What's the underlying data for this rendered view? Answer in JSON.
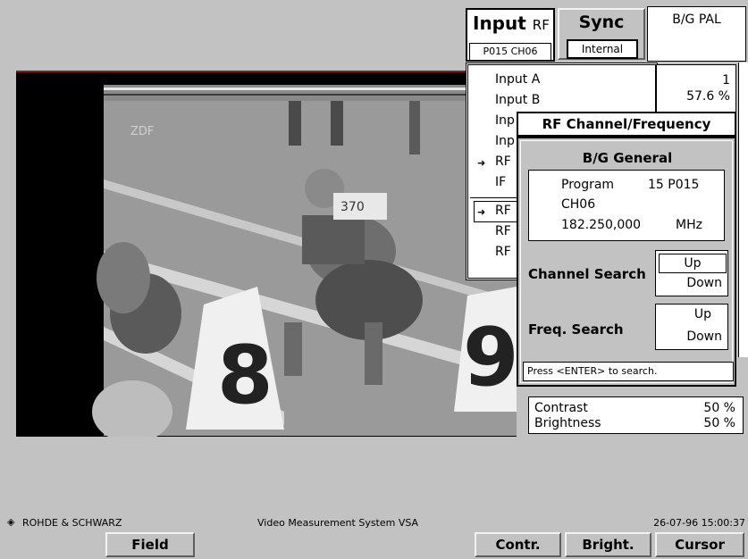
{
  "tabs": {
    "input": {
      "label": "Input",
      "source": "RF",
      "sub": "P015 CH06"
    },
    "sync": {
      "label": "Sync",
      "sub": "Internal"
    },
    "standard": {
      "label": "B/G PAL"
    }
  },
  "input_menu": {
    "items": [
      "Input A",
      "Input B",
      "Inp",
      "Inp",
      "RF",
      "IF",
      "RF",
      "RF",
      "RF"
    ],
    "selected_indices": [
      4,
      6
    ]
  },
  "info": {
    "line1": "1",
    "line2": "57.6 %"
  },
  "rf_dialog": {
    "title": "RF Channel/Frequency",
    "general_title": "B/G General",
    "program_label": "Program",
    "program_value": "15 P015",
    "channel": "CH06",
    "frequency": "182.250,000",
    "unit": "MHz",
    "channel_search_label": "Channel Search",
    "freq_search_label": "Freq. Search",
    "up_label": "Up",
    "down_label": "Down",
    "hint": "Press <ENTER> to search."
  },
  "video_overlay": {
    "station": "ZDF"
  },
  "picture_settings": {
    "contrast_label": "Contrast",
    "contrast_value": "50 %",
    "brightness_label": "Brightness",
    "brightness_value": "50 %"
  },
  "footer": {
    "brand": "ROHDE & SCHWARZ",
    "system": "Video Measurement System VSA",
    "datetime": "26-07-96 15:00:37"
  },
  "softkeys": {
    "field": "Field",
    "contr": "Contr.",
    "bright": "Bright.",
    "cursor": "Cursor"
  }
}
